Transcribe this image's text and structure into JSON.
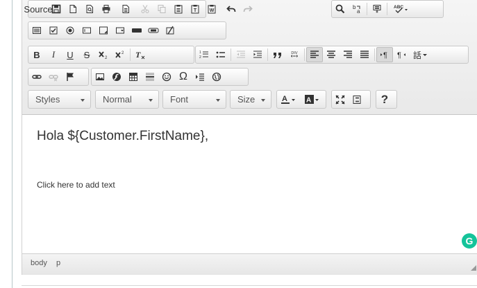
{
  "toolbar": {
    "row1": {
      "source_label": "Source"
    },
    "combos": {
      "styles": "Styles",
      "format": "Normal",
      "font": "Font",
      "size": "Size"
    },
    "help_label": "?",
    "div_label_top": "DIV",
    "abc_label": "ABC",
    "b_label": "B",
    "i_label": "I",
    "u_label": "U",
    "s_label": "S",
    "omega_label": "Ω",
    "pilcrow_label": "¶",
    "format_label": "T",
    "lang_label": "話"
  },
  "content": {
    "greeting": "Hola ${Customer.FirstName},",
    "placeholder": "Click here to add text"
  },
  "statusbar": {
    "path": [
      "body",
      "p"
    ]
  },
  "grammarly": {
    "letter": "G",
    "color": "#15c39a"
  },
  "colors": {
    "toolbar_bg": "#eeeeee",
    "border": "#c8c8c8",
    "text": "#333333"
  }
}
